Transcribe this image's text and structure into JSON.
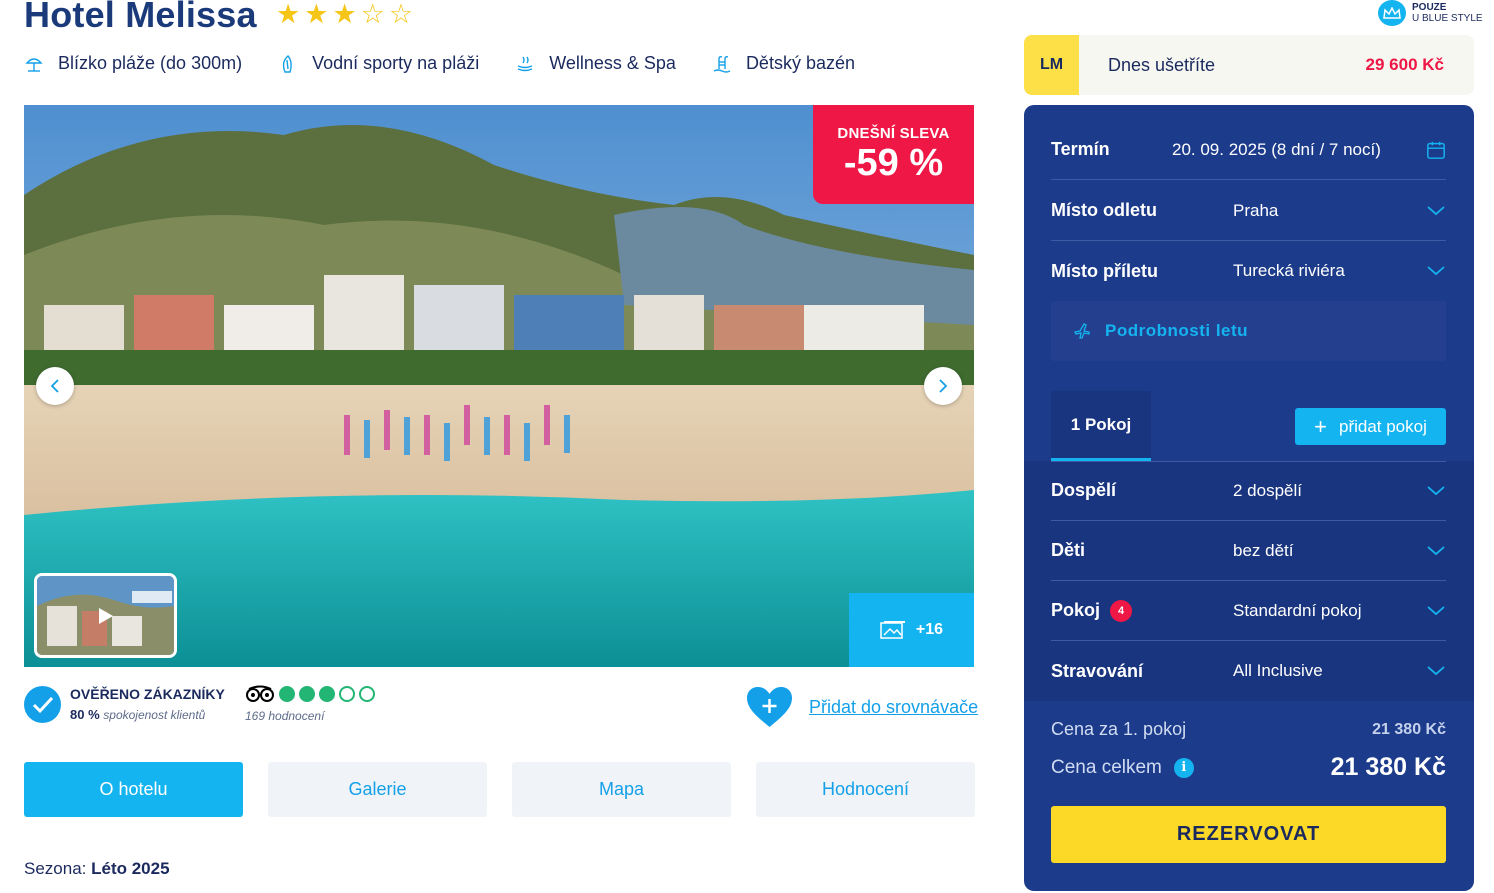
{
  "hotel": {
    "name": "Hotel Melissa",
    "stars_total": 5,
    "stars_filled": 3
  },
  "features": [
    {
      "label": "Blízko pláže (do 300m)",
      "icon": "beach-umbrella-icon"
    },
    {
      "label": "Vodní sporty na pláži",
      "icon": "surfboard-icon"
    },
    {
      "label": "Wellness & Spa",
      "icon": "spa-icon"
    },
    {
      "label": "Dětský bazén",
      "icon": "pool-ladder-icon"
    }
  ],
  "gallery": {
    "discount_label": "DNEŠNÍ SLEVA",
    "discount_value": "-59 %",
    "more_photos": "+16"
  },
  "verified": {
    "title": "OVĚŘENO ZÁKAZNÍKY",
    "percent": "80 %",
    "percent_label": "spokojenost klientů"
  },
  "tripadvisor": {
    "rating_filled": 3,
    "rating_total": 5,
    "reviews": "169 hodnocení"
  },
  "compare": {
    "link": "Přidat do srovnávače"
  },
  "tabs": [
    "O hotelu",
    "Galerie",
    "Mapa",
    "Hodnocení"
  ],
  "season": {
    "label": "Sezona:",
    "value": "Léto 2025"
  },
  "blue_style": {
    "line1": "POUZE",
    "line2": "U BLUE STYLE"
  },
  "lastminute": {
    "badge": "LM",
    "label": "Dnes ušetříte",
    "value": "29 600 Kč"
  },
  "booking": {
    "term_label": "Termín",
    "term_value": "20. 09. 2025 (8 dní / 7 nocí)",
    "departure_label": "Místo odletu",
    "departure_value": "Praha",
    "arrival_label": "Místo příletu",
    "arrival_value": "Turecká riviéra",
    "flight_details": "Podrobnosti letu",
    "room_tab": "1 Pokoj",
    "add_room": "přidat pokoj",
    "adults_label": "Dospělí",
    "adults_value": "2 dospělí",
    "children_label": "Děti",
    "children_value": "bez dětí",
    "room_label": "Pokoj",
    "room_badge": "4",
    "room_value": "Standardní pokoj",
    "board_label": "Stravování",
    "board_value": "All Inclusive",
    "price_per_room_label": "Cena za 1. pokoj",
    "price_per_room": "21 380 Kč",
    "price_total_label": "Cena celkem",
    "price_total": "21 380 Kč",
    "reserve": "REZERVOVAT"
  },
  "colors": {
    "brand_blue": "#1d3b8b",
    "accent_cyan": "#14b4f0",
    "discount_red": "#ee1745",
    "reserve_yellow": "#fcd827",
    "lm_yellow": "#fde047"
  }
}
